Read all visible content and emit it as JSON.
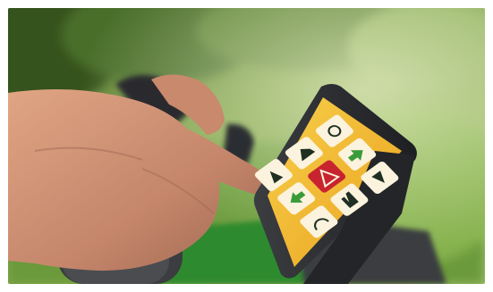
{
  "photo": {
    "subject": "hand-pressing-tractor-armrest-touch-display",
    "colors": {
      "background_green": "#6f9a3e",
      "foliage_dark": "#3f5e26",
      "skin": "#c98f6f",
      "screen_panel": "#f2b92f",
      "button_face": "#fbf3dd",
      "button_icon": "#1f2f22",
      "arrow_green": "#3a9b3a",
      "warning_red": "#c8242f",
      "device_dark": "#2c2e31",
      "seat_green": "#2f8a2f"
    },
    "buttons": [
      {
        "icon": "lift-up-icon"
      },
      {
        "icon": "arrow-left-icon"
      },
      {
        "icon": "hazard-warning-icon"
      },
      {
        "icon": "tractor-mode-icon"
      },
      {
        "icon": "speed-set-icon"
      },
      {
        "icon": "arrow-right-icon"
      },
      {
        "icon": "hand-control-icon"
      },
      {
        "icon": "beacon-light-icon"
      },
      {
        "icon": "lift-down-icon"
      }
    ]
  }
}
